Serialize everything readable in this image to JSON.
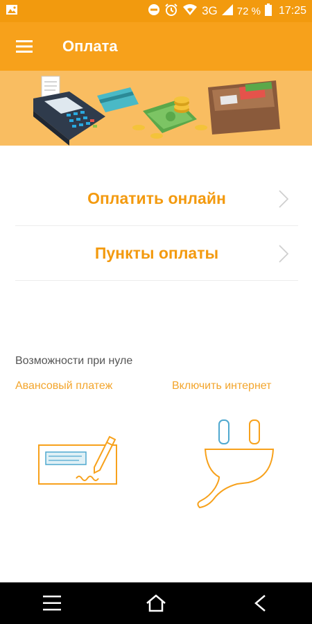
{
  "status_bar": {
    "battery": "72 %",
    "network": "3G",
    "time": "17:25"
  },
  "app_bar": {
    "title": "Оплата"
  },
  "menu": {
    "items": [
      {
        "label": "Оплатить онлайн"
      },
      {
        "label": "Пункты оплаты"
      }
    ]
  },
  "zero_balance": {
    "title": "Возможности при нуле",
    "options": [
      {
        "label": "Авансовый платеж",
        "icon": "check-icon"
      },
      {
        "label": "Включить интернет",
        "icon": "plug-icon"
      }
    ]
  },
  "colors": {
    "accent": "#f7a11b",
    "status_bar": "#f29a0e",
    "banner": "#f9bd61",
    "link": "#f3a52c",
    "icon_line": "#f7a11b",
    "icon_blue": "#4fa8cf"
  }
}
